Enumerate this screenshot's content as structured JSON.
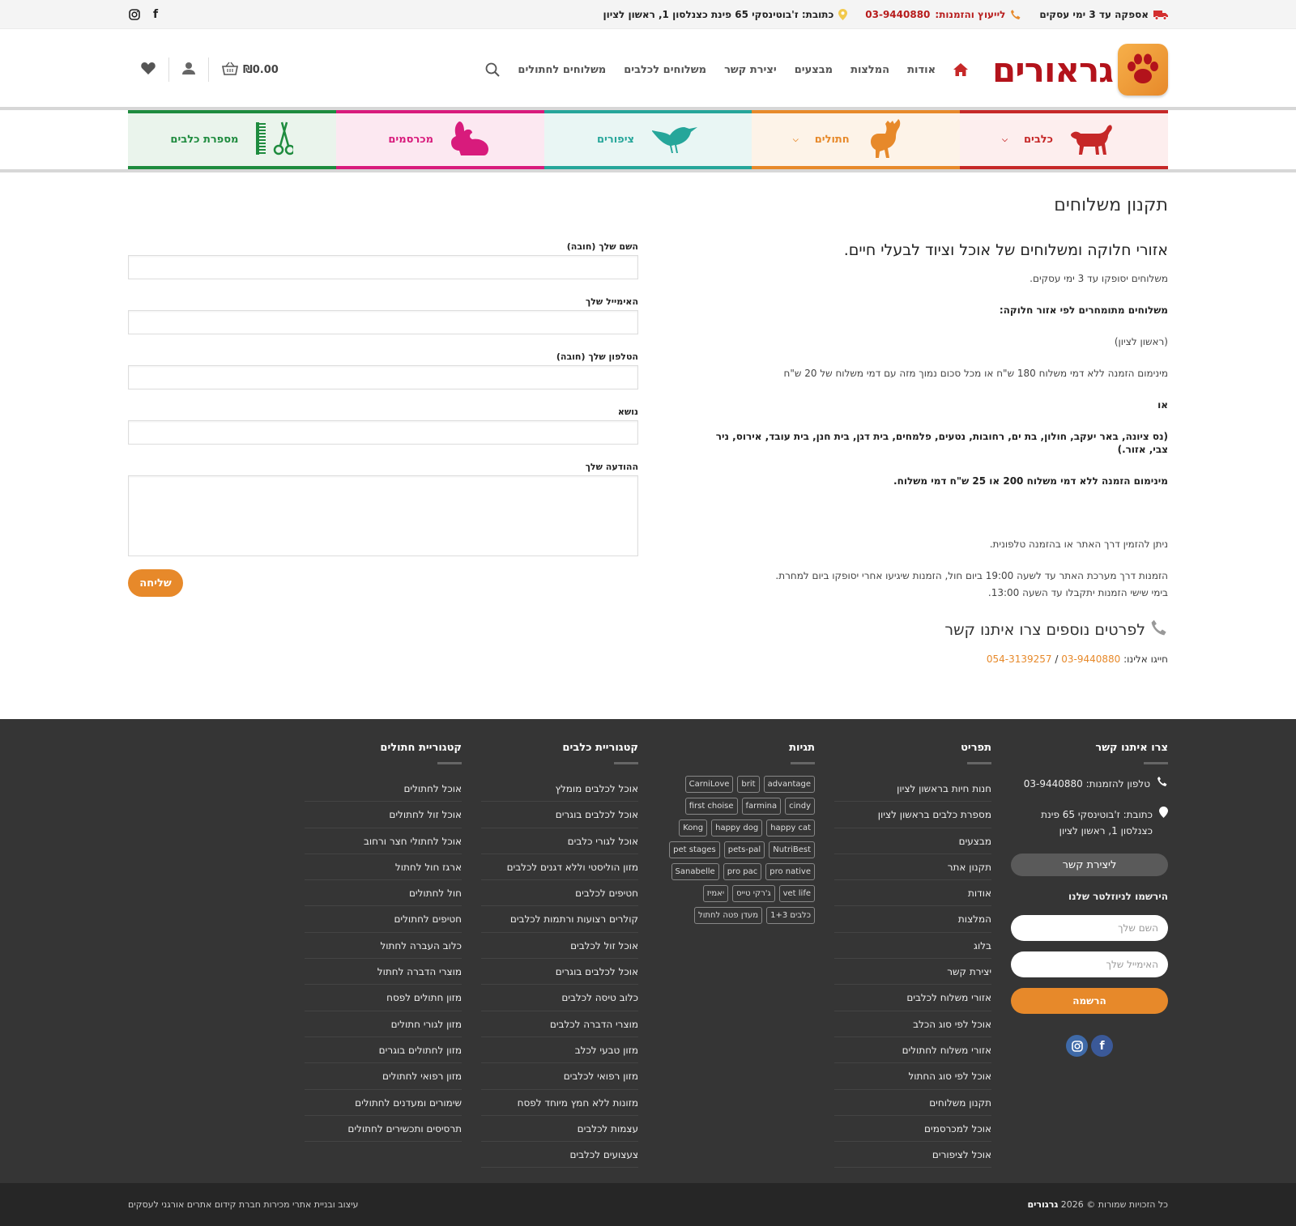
{
  "topbar": {
    "shipping": "אספקה עד 3 ימי עסקים",
    "phone_label": "לייעוץ והזמנות:",
    "phone": "03-9440880",
    "address": "כתובת: ז'בוטינסקי 65 פינת כצנלסון 1, ראשון לציון",
    "social": [
      "instagram-icon",
      "facebook-icon"
    ]
  },
  "header": {
    "logo_text": "גראורים",
    "nav": [
      "אודות",
      "המלצות",
      "מבצעים",
      "יצירת קשר",
      "משלוחים לכלבים",
      "משלוחים לחתולים"
    ],
    "cart_total": "₪0.00"
  },
  "categories": [
    {
      "label": "כלבים",
      "dropdown": true
    },
    {
      "label": "חתולים",
      "dropdown": true
    },
    {
      "label": "ציפורים",
      "dropdown": false
    },
    {
      "label": "מכרסמים",
      "dropdown": false
    },
    {
      "label": "מספרת כלבים",
      "dropdown": false
    }
  ],
  "page": {
    "title": "תקנון משלוחים",
    "heading": "אזורי חלוקה ומשלוחים של אוכל וציוד לבעלי חיים.",
    "p1": "משלוחים יסופקו עד 3 ימי עסקים.",
    "p2": "משלוחים מתומחרים לפי אזור חלוקה:",
    "p3": "(ראשון לציון)",
    "p4": "מינימום הזמנה ללא דמי משלוח 180 ש\"ח או מכל סכום נמוך מזה עם דמי משלוח של 20 ש\"ח",
    "p5": "או",
    "p6": "(נס ציונה, באר יעקב, חולון, בת ים, רחובות, נטעים, פלמחים, בית דגן, בית חנן, בית עובד, אירוס, ניר צבי, אזור.)",
    "p7": "מינימום הזמנה ללא דמי משלוח 200 או 25 ש\"ח דמי משלוח.",
    "p8": "ניתן להזמין דרך האתר או בהזמנה טלפונית.",
    "p9": "הזמנות דרך מערכת האתר עד לשעה 19:00 ביום חול, הזמנות שיגיעו אחרי יסופקו ביום למחרת.",
    "p10": "בימי שישי הזמנות יתקבלו עד השעה 13:00.",
    "contact_heading": "לפרטים נוספים צרו איתנו קשר",
    "dial_label": "חייגו אלינו:",
    "phone1": "03-9440880",
    "phone_sep": " / ",
    "phone2": "054-3139257"
  },
  "form": {
    "name_label": "השם שלך (חובה)",
    "email_label": "האימייל שלך",
    "phone_label": "הטלפון שלך (חובה)",
    "subject_label": "נושא",
    "message_label": "ההודעה שלך",
    "submit": "שליחה"
  },
  "footer": {
    "contact": {
      "title": "צרו איתנו קשר",
      "phone": "טלפון להזמנות: 03-9440880",
      "address": "כתובת: ז'בוטינסקי 65 פינת כצנלסון 1, ראשון לציון",
      "button": "ליצירת קשר",
      "newsletter_title": "הירשמו לניוזלטר שלנו",
      "name_placeholder": "השם שלך",
      "email_placeholder": "האימייל שלך",
      "subscribe": "הרשמה"
    },
    "menu": {
      "title": "תפריט",
      "items": [
        "חנות חיות בראשון לציון",
        "מספרת כלבים בראשון לציון",
        "מבצעים",
        "תקנון אתר",
        "אודות",
        "המלצות",
        "בלוג",
        "יצירת קשר",
        "אזורי משלוח לכלבים",
        "אוכל לפי סוג הכלב",
        "אזורי משלוח לחתולים",
        "אוכל לפי סוג החתול",
        "תקנון משלוחים",
        "אוכל למכרסמים",
        "אוכל לציפורים"
      ]
    },
    "tags": {
      "title": "תגיות",
      "items": [
        "advantage",
        "brit",
        "CarniLove",
        "cindy",
        "farmina",
        "first choise",
        "happy cat",
        "happy dog",
        "Kong",
        "NutriBest",
        "pets-pal",
        "pet stages",
        "pro native",
        "pro pac",
        "Sanabelle",
        "vet life",
        "ג'רקי טייס",
        "יאמיז",
        "כלבים 1+3",
        "מעדן פטה לחתול"
      ]
    },
    "dogs": {
      "title": "קטגוריית כלבים",
      "items": [
        "אוכל לכלבים מומלץ",
        "אוכל לכלבים בוגרים",
        "אוכל לגורי כלבים",
        "מזון הוליסטי וללא דגנים לכלבים",
        "חטיפים לכלבים",
        "קולרים רצועות ורתמות לכלבים",
        "אוכל זול לכלבים",
        "אוכל לכלבים בוגרים",
        "כלוב טיסה לכלבים",
        "מוצרי הדברה לכלבים",
        "מזון טבעי לכלב",
        "מזון רפואי לכלבים",
        "מזונות ללא חמץ מיוחד לפסח",
        "עצמות לכלבים",
        "צעצועים לכלבים"
      ]
    },
    "cats": {
      "title": "קטגוריית חתולים",
      "items": [
        "אוכל לחתולים",
        "אוכל זול לחתולים",
        "אוכל לחתולי חצר ורחוב",
        "ארגז חול לחתול",
        "חול לחתולים",
        "חטיפים לחתולים",
        "כלוב העברה לחתול",
        "מוצרי הדברה לחתול",
        "מזון חתולים לפסח",
        "מזון לגורי חתולים",
        "מזון לחתולים בוגרים",
        "מזון רפואי לחתולים",
        "שימורים ומעדנים לחתולים",
        "תרסיסים ותכשירים לחתולים"
      ]
    }
  },
  "bottom": {
    "copyright_prefix": "כל הזכויות שמורות © 2026",
    "brand": "גרגורים",
    "credit": "עיצוב ובניית אתרי מכירות חברת קידום אתרים אורגני לעסקים"
  },
  "colors": {
    "accent": "#e7892a",
    "brand_red": "#b3131b",
    "dogs": "#c62828",
    "cats": "#e7892a",
    "birds": "#26a69a",
    "rodents": "#d81b7c",
    "grooming": "#1e8b3e",
    "footer_bg": "#353535"
  }
}
